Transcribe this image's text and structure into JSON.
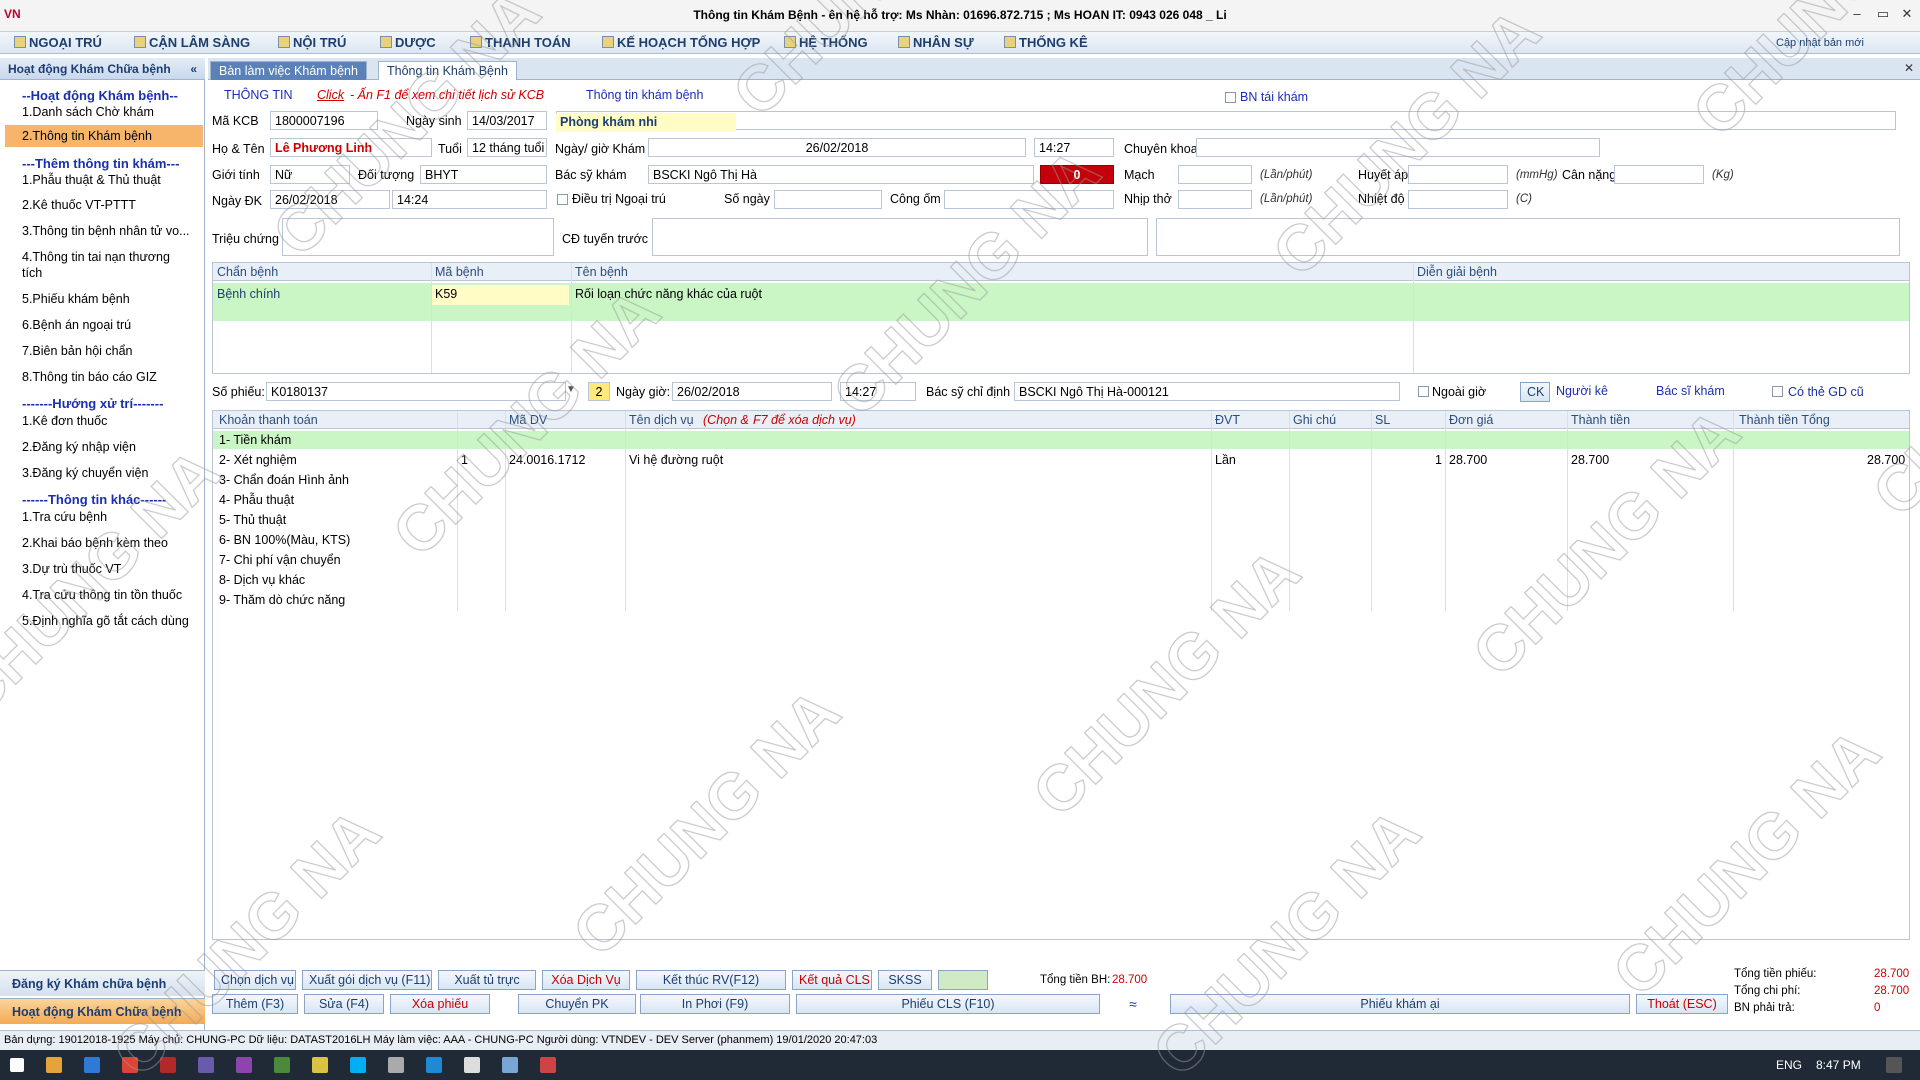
{
  "window": {
    "logo": "VN",
    "title": "Thông tin Khám Bệnh - ên hệ hỗ trợ: Ms Nhàn: 01696.872.715 ; Ms HOAN IT: 0943 026 048 _ Li",
    "min": "–",
    "max": "▭",
    "close": "✕"
  },
  "menu": [
    "NGOẠI TRÚ",
    "CẬN LÂM SÀNG",
    "NỘI TRÚ",
    "DƯỢC",
    "THANH TOÁN",
    "KẾ HOẠCH TỔNG HỢP",
    "HỆ THỐNG",
    "NHÂN SỰ",
    "THỐNG KÊ"
  ],
  "update_label": "Cập nhật bản mới",
  "sidebar": {
    "header": "Hoạt động Khám Chữa bệnh",
    "collapse": "«",
    "sections": [
      {
        "heading": "--Hoạt động Khám bệnh--",
        "items": [
          "1.Danh sách Chờ khám",
          "2.Thông tin Khám bệnh"
        ]
      },
      {
        "heading": "---Thêm thông tin khám---",
        "items": [
          "1.Phẫu thuật & Thủ thuật",
          "2.Kê thuốc VT-PTTT",
          "3.Thông tin bệnh nhân tử vo...",
          "4.Thông tin tai nạn thương",
          "tích",
          "5.Phiếu khám bệnh",
          "6.Bệnh án ngoại trú",
          "7.Biên bản hội chẩn",
          "8.Thông tin báo cáo GIZ"
        ]
      },
      {
        "heading": "-------Hướng xử trí-------",
        "items": [
          "1.Kê đơn thuốc",
          "2.Đăng ký nhập viện",
          "3.Đăng ký chuyển viện"
        ]
      },
      {
        "heading": "------Thông tin khác------",
        "items": [
          "1.Tra cứu bệnh",
          "2.Khai báo bệnh kèm theo",
          "3.Dự trù thuốc VT",
          "4.Tra cứu thông tin tồn thuốc",
          "5.Định nghĩa gõ tắt cách dùng"
        ]
      }
    ],
    "bottom1": "Đăng ký Khám chữa bệnh",
    "bottom2": "Hoạt động Khám Chữa bệnh"
  },
  "tabs": [
    "Bàn làm việc Khám bệnh",
    "Thông tin Khám Bệnh"
  ],
  "tab_close": "✕",
  "info": {
    "thongtin": "THÔNG TIN",
    "click": "Click",
    "hint": " - Ấn F1 để xem chi tiết lịch sử KCB",
    "kb_title": "Thông tin khám bệnh",
    "bn_tai_kham": "BN tái khám",
    "ma_kcb_lbl": "Mã KCB",
    "ma_kcb": "1800007196",
    "ngay_sinh_lbl": "Ngày sinh",
    "ngay_sinh": "14/03/2017",
    "phong_kham": "Phòng khám nhi",
    "ho_ten_lbl": "Họ & Tên",
    "ho_ten": "Lê Phương Linh",
    "tuoi_lbl": "Tuổi",
    "tuoi": "12 tháng tuổi",
    "ngay_gio_kham_lbl": "Ngày/ giờ Khám",
    "ngay_kham": "26/02/2018",
    "gio_kham": "14:27",
    "chuyen_khoa_lbl": "Chuyên khoa",
    "gioi_tinh_lbl": "Giới tính",
    "gioi_tinh": "Nữ",
    "doi_tuong_lbl": "Đối tượng",
    "doi_tuong": "BHYT",
    "bac_si_lbl": "Bác sỹ khám",
    "bac_si": "BSCKI Ngô Thị Hà",
    "red_count": "0",
    "mach_lbl": "Mạch",
    "mach_unit": "(Lần/phút)",
    "huyet_ap_lbl": "Huyết áp",
    "huyet_ap_unit": "(mmHg)",
    "can_nang_lbl": "Cân nặng",
    "can_nang_unit": "(Kg)",
    "ngay_dk_lbl": "Ngày ĐK",
    "ngay_dk": "26/02/2018",
    "gio_dk": "14:24",
    "dieu_tri_lbl": "Điều trị Ngoại trú",
    "so_ngay_lbl": "Số ngày",
    "cong_om_lbl": "Công ốm",
    "nhip_tho_lbl": "Nhịp thở",
    "nhip_tho_unit": "(Lần/phút)",
    "nhiet_do_lbl": "Nhiệt độ",
    "nhiet_do_unit": "(C)",
    "trieu_chung_lbl": "Triệu chứng",
    "cd_tuyen_truoc_lbl": "CĐ tuyến trước"
  },
  "diag": {
    "headers": [
      "Chẩn bệnh",
      "Mã bệnh",
      "Tên bệnh",
      "Diễn giải bệnh"
    ],
    "row": {
      "chan_benh": "Bệnh chính",
      "ma_benh": "K59",
      "ten_benh": "Rối loạn chức năng khác của ruột"
    }
  },
  "phieu": {
    "so_phieu_lbl": "Số phiếu:",
    "so_phieu": "K0180137",
    "count": "2",
    "ngay_gio_lbl": "Ngày giờ:",
    "ngay": "26/02/2018",
    "gio": "14:27",
    "bs_chi_dinh_lbl": "Bác sỹ chỉ định",
    "bs_chi_dinh": "BSCKI Ngô Thị Hà-000121",
    "ngoai_gio": "Ngoài giờ",
    "ck": "CK",
    "nguoi_ke": "Người kê",
    "bs_kham": "Bác sĩ khám",
    "co_the_gd": "Có thẻ GD cũ"
  },
  "services": {
    "headers": [
      "Khoản thanh toán",
      "",
      "Mã DV",
      "Tên dịch vụ",
      "(Chọn &",
      "F7 để xóa dịch vụ)",
      "ĐVT",
      "Ghi chú",
      "SL",
      "Đơn giá",
      "Thành tiền",
      "Thành tiền Tổng"
    ],
    "rows": [
      {
        "group": "1- Tiền khám"
      },
      {
        "group": "2- Xét nghiệm",
        "stt": "1",
        "ma_dv": "24.0016.1712",
        "ten": "Vi hệ đường ruột",
        "dvt": "Lần",
        "sl": "1",
        "don_gia": "28.700",
        "thanh_tien": "28.700",
        "tong": "28.700"
      },
      {
        "group": "3- Chẩn đoán Hình ảnh"
      },
      {
        "group": "4- Phẫu thuật"
      },
      {
        "group": "5- Thủ thuật"
      },
      {
        "group": "6- BN 100%(Màu, KTS)"
      },
      {
        "group": "7- Chi phí vận chuyển"
      },
      {
        "group": "8- Dịch vụ khác"
      },
      {
        "group": "9- Thăm dò chức năng"
      }
    ]
  },
  "actions1": [
    "Chọn dịch vụ",
    "Xuất gói dịch vụ (F11)",
    "Xuất tủ trực",
    "Xóa Dịch Vụ",
    "Kết thúc RV(F12)",
    "Kết quả CLS",
    "SKSS"
  ],
  "actions2": [
    "Thêm (F3)",
    "Sửa (F4)",
    "Xóa phiếu",
    "Chuyển PK",
    "In Phơi (F9)",
    "Phiếu CLS (F10)",
    "Phiếu khám ại",
    "Thoát (ESC)"
  ],
  "totals": {
    "tong_bh_lbl": "Tổng tiền BH:",
    "tong_bh": "28.700",
    "tong_phieu_lbl": "Tổng tiền phiếu:",
    "tong_phieu": "28.700",
    "tong_chi_phi_lbl": "Tổng chi phí:",
    "tong_chi_phi": "28.700",
    "bn_phai_tra_lbl": "BN phải trả:",
    "bn_phai_tra": "0"
  },
  "status": "Bản dựng: 19012018-1925   Máy chủ: CHUNG-PC   Dữ liệu: DATAST2016LH   Máy làm việc: AAA - CHUNG-PC   Người dùng: VTNDEV - DEV Server (phanmem)   19/01/2020 20:47:03",
  "taskbar": {
    "lang": "ENG",
    "time": "8:47 PM"
  },
  "watermark": "CHUNG NA"
}
